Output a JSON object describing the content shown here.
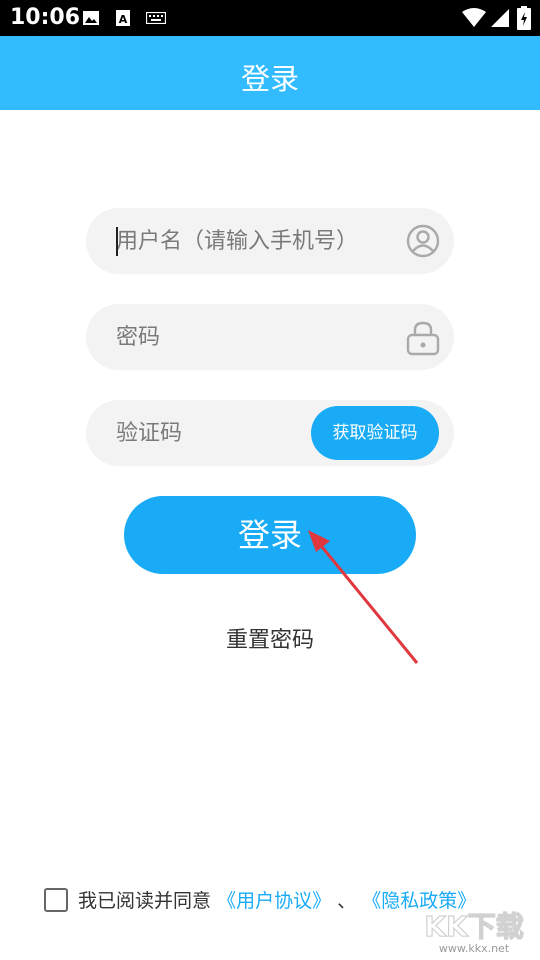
{
  "status_bar": {
    "time": "10:06",
    "icons": [
      "image-icon",
      "font-icon",
      "keyboard-icon",
      "wifi-icon",
      "signal-icon",
      "battery-icon"
    ]
  },
  "app_bar": {
    "title": "登录"
  },
  "form": {
    "username": {
      "value": "",
      "placeholder": "用户名（请输入手机号）",
      "icon": "user-icon"
    },
    "password": {
      "value": "",
      "placeholder": "密码",
      "icon": "lock-icon"
    },
    "verify_code": {
      "value": "",
      "placeholder": "验证码",
      "button_label": "获取验证码"
    },
    "login_label": "登录",
    "reset_label": "重置密码"
  },
  "agreement": {
    "prefix": "我已阅读并同意",
    "user_agreement": "《用户协议》",
    "separator": "、",
    "privacy_policy": "《隐私政策》",
    "checked": false
  },
  "watermark": {
    "brand": "KK下载",
    "site": "www.kkx.net"
  },
  "colors": {
    "app_bar": "#33bbff",
    "primary_button": "#1aabf7",
    "field_bg": "#f3f3f3",
    "arrow": "#e0383e"
  }
}
